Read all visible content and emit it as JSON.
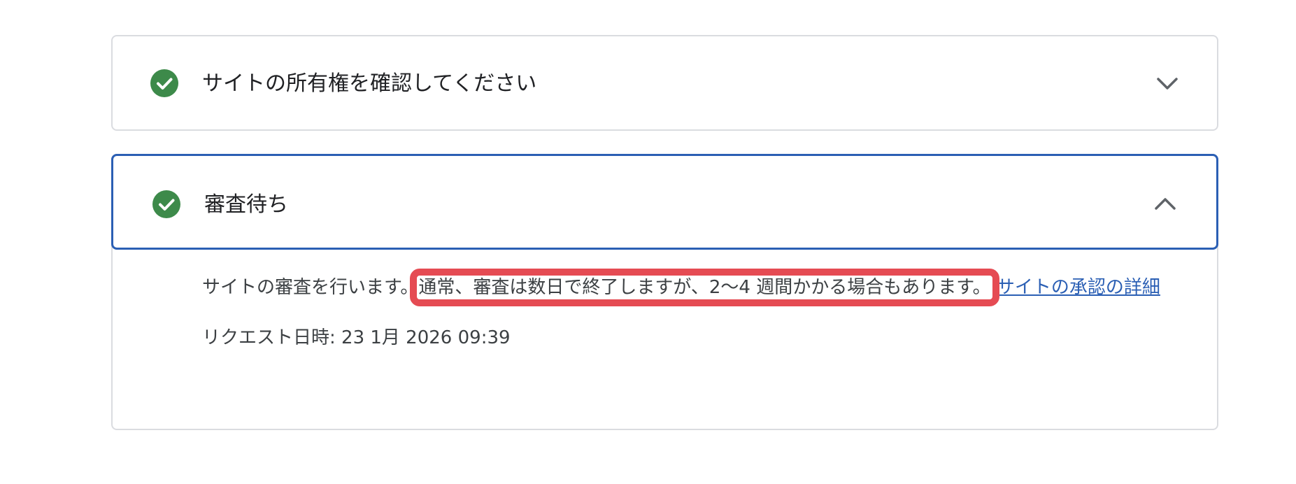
{
  "steps": [
    {
      "title": "サイトの所有権を確認してください",
      "status": "complete",
      "expanded": false
    },
    {
      "title": "審査待ち",
      "status": "complete",
      "expanded": true,
      "description_before": "サイトの審査を行います。",
      "description_highlighted": "通常、審査は数日で終了しますが、2〜4 週間かかる場合もあります。",
      "learn_more_link": "サイトの承認の詳細",
      "request_date": "リクエスト日時: 23 1月 2026 09:39"
    }
  ],
  "colors": {
    "check_green": "#3d8a4a",
    "active_border": "#2b5fb4",
    "highlight_red": "#e54b53",
    "link_blue": "#2b5fb4"
  },
  "icons": {
    "status": "check-circle-icon",
    "collapsed": "chevron-down-icon",
    "expanded": "chevron-up-icon"
  }
}
